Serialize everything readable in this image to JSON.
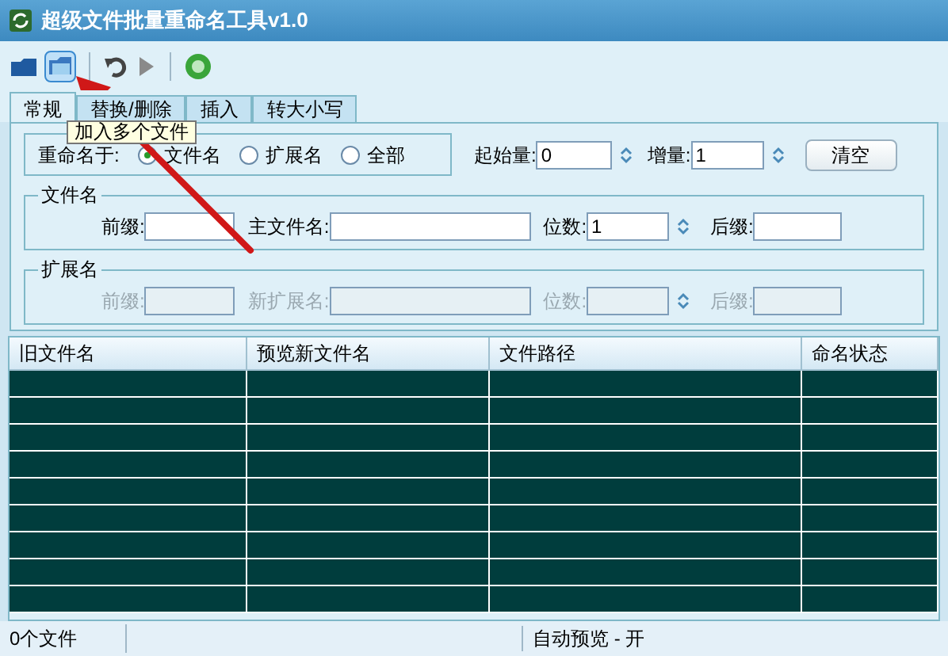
{
  "window": {
    "title": "超级文件批量重命名工具v1.0"
  },
  "toolbar": {
    "tooltip": "加入多个文件"
  },
  "tabs": [
    {
      "label": "常规",
      "selected": true
    },
    {
      "label": "替换/删除",
      "selected": false
    },
    {
      "label": "插入",
      "selected": false
    },
    {
      "label": "转大小写",
      "selected": false
    }
  ],
  "rename_target": {
    "label": "重命名于:",
    "options": [
      {
        "label": "文件名",
        "selected": true
      },
      {
        "label": "扩展名",
        "selected": false
      },
      {
        "label": "全部",
        "selected": false
      }
    ]
  },
  "start": {
    "label": "起始量:",
    "value": "0"
  },
  "step": {
    "label": "增量:",
    "value": "1"
  },
  "clear_button": "清空",
  "filename_group": {
    "title": "文件名",
    "disabled": false,
    "fields": [
      {
        "label": "前缀:"
      },
      {
        "label": "主文件名:"
      },
      {
        "label": "位数:",
        "value": "1",
        "kind": "spin"
      },
      {
        "label": "后缀:"
      }
    ]
  },
  "extension_group": {
    "title": "扩展名",
    "disabled": true,
    "fields": [
      {
        "label": "前缀:"
      },
      {
        "label": "新扩展名:"
      },
      {
        "label": "位数:",
        "kind": "spin"
      },
      {
        "label": "后缀:"
      }
    ]
  },
  "table": {
    "columns": [
      "旧文件名",
      "预览新文件名",
      "文件路径",
      "命名状态"
    ]
  },
  "status_bar": [
    "0个文件",
    "自动预览 - 开"
  ]
}
